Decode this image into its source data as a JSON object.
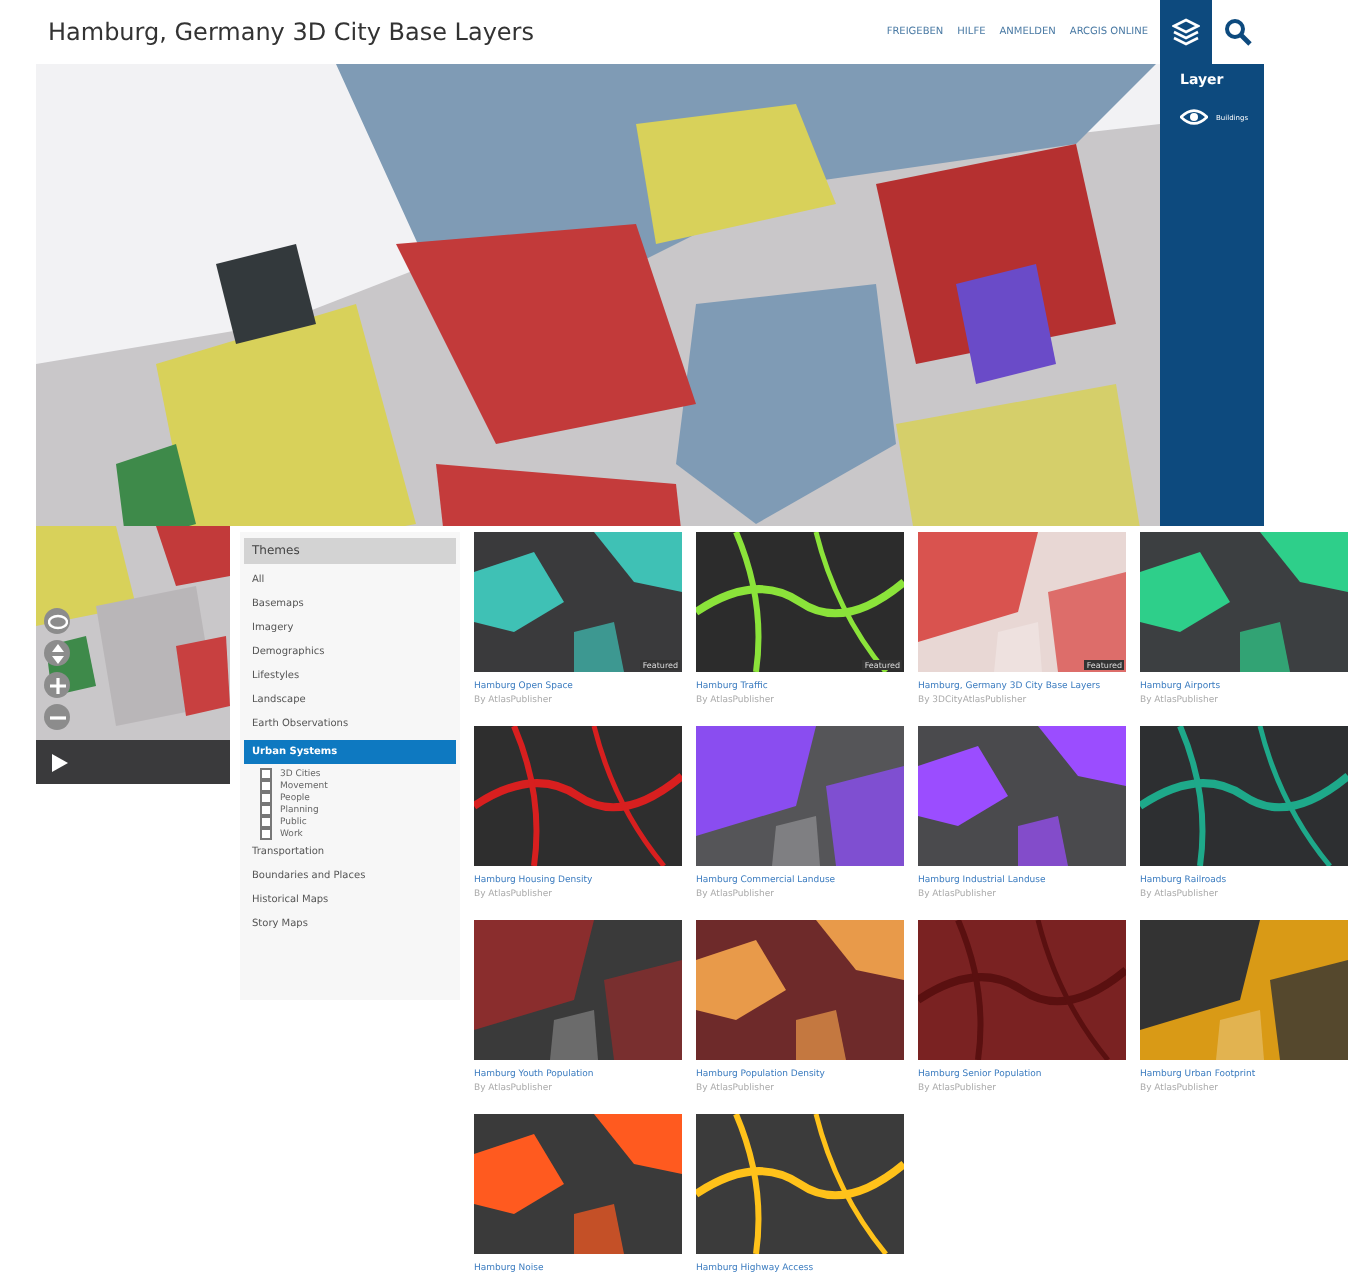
{
  "app": {
    "title": "Hamburg, Germany 3D City Base Layers",
    "nav": [
      "FREIGEBEN",
      "HILFE",
      "ANMELDEN",
      "ARCGIS ONLINE"
    ],
    "panel": {
      "title": "Layer",
      "layer": "Buildings"
    }
  },
  "gallery": {
    "heading": "Themes",
    "themes": [
      {
        "label": "All",
        "selected": false
      },
      {
        "label": "Basemaps",
        "selected": false
      },
      {
        "label": "Imagery",
        "selected": false
      },
      {
        "label": "Demographics",
        "selected": false
      },
      {
        "label": "Lifestyles",
        "selected": false
      },
      {
        "label": "Landscape",
        "selected": false
      },
      {
        "label": "Earth Observations",
        "selected": false
      },
      {
        "label": "Urban Systems",
        "selected": true,
        "children": [
          {
            "label": "3D Cities",
            "checked": false
          },
          {
            "label": "Movement",
            "checked": false
          },
          {
            "label": "People",
            "checked": false
          },
          {
            "label": "Planning",
            "checked": false
          },
          {
            "label": "Public",
            "checked": false
          },
          {
            "label": "Work",
            "checked": false
          }
        ]
      },
      {
        "label": "Transportation",
        "selected": false
      },
      {
        "label": "Boundaries and Places",
        "selected": false
      },
      {
        "label": "Historical Maps",
        "selected": false
      },
      {
        "label": "Story Maps",
        "selected": false
      }
    ],
    "items": [
      {
        "title": "Hamburg Open Space",
        "author": "By AtlasPublisher",
        "badge": "Featured"
      },
      {
        "title": "Hamburg Traffic",
        "author": "By AtlasPublisher",
        "badge": "Featured"
      },
      {
        "title": "Hamburg, Germany 3D City Base Layers",
        "author": "By 3DCityAtlasPublisher",
        "badge": "Featured"
      },
      {
        "title": "Hamburg Airports",
        "author": "By AtlasPublisher"
      },
      {
        "title": "Hamburg Housing Density",
        "author": "By AtlasPublisher"
      },
      {
        "title": "Hamburg Commercial Landuse",
        "author": "By AtlasPublisher"
      },
      {
        "title": "Hamburg Industrial Landuse",
        "author": "By AtlasPublisher"
      },
      {
        "title": "Hamburg Railroads",
        "author": "By AtlasPublisher"
      },
      {
        "title": "Hamburg Youth Population",
        "author": "By AtlasPublisher"
      },
      {
        "title": "Hamburg Population Density",
        "author": "By AtlasPublisher"
      },
      {
        "title": "Hamburg Senior Population",
        "author": "By AtlasPublisher"
      },
      {
        "title": "Hamburg Urban Footprint",
        "author": "By AtlasPublisher"
      },
      {
        "title": "Hamburg Noise"
      },
      {
        "title": "Hamburg Highway Access"
      }
    ]
  }
}
